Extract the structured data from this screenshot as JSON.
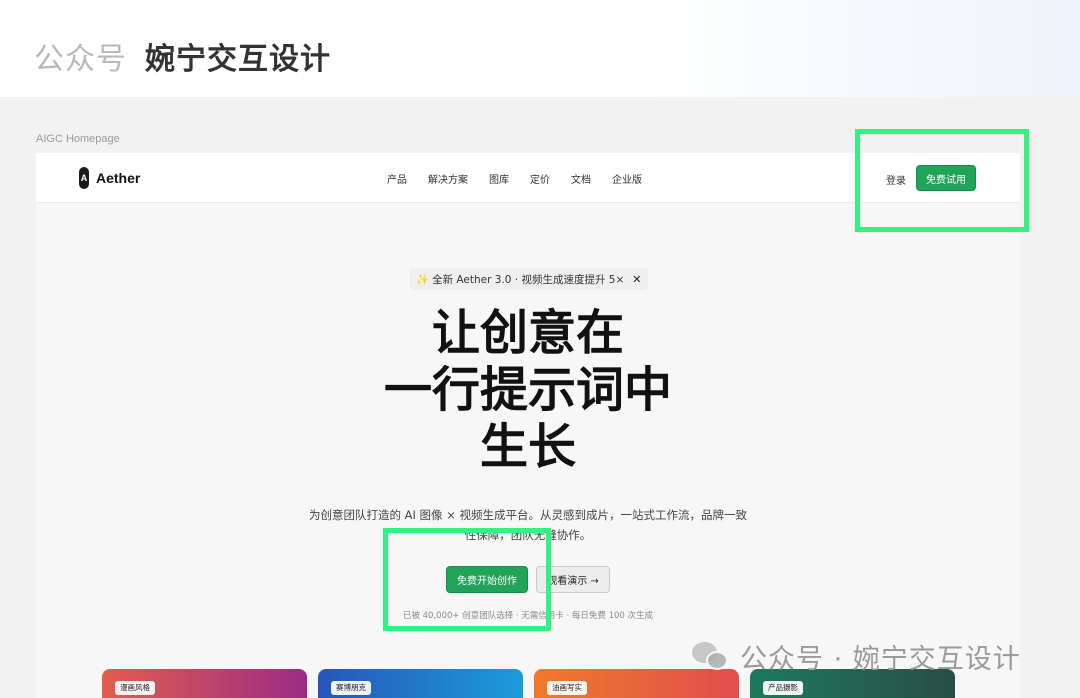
{
  "watermark_header": {
    "prefix": "公众号",
    "name": "婉宁交互设计"
  },
  "frame_label": "AIGC Homepage",
  "nav": {
    "brand": "Aether",
    "brand_mark": "A",
    "links": [
      "产品",
      "解决方案",
      "图库",
      "定价",
      "文档",
      "企业版"
    ],
    "login_label": "登录",
    "trial_label": "免费试用"
  },
  "hero": {
    "badge_text": "全新 Aether 3.0 · 视频生成速度提升 5×",
    "badge_spark": "✨",
    "badge_close": "✕",
    "headline_lines": [
      "让创意在",
      "一行提示词中",
      "生长"
    ],
    "subtitle": "为创意团队打造的 AI 图像 × 视频生成平台。从灵感到成片，一站式工作流，品牌一致性保障，团队无缝协作。",
    "cta_primary": "免费开始创作",
    "cta_secondary": "观看演示 →",
    "social_proof": "已被 40,000+ 创意团队选择 · 无需信用卡 · 每日免费 100 次生成"
  },
  "cards": [
    {
      "tag": "漫画风格"
    },
    {
      "tag": "赛博朋克"
    },
    {
      "tag": "油画写实"
    },
    {
      "tag": "产品摄影"
    }
  ],
  "wechat_watermark": "公众号 · 婉宁交互设计",
  "colors": {
    "accent": "#22a35a",
    "highlight": "#33f27f"
  }
}
